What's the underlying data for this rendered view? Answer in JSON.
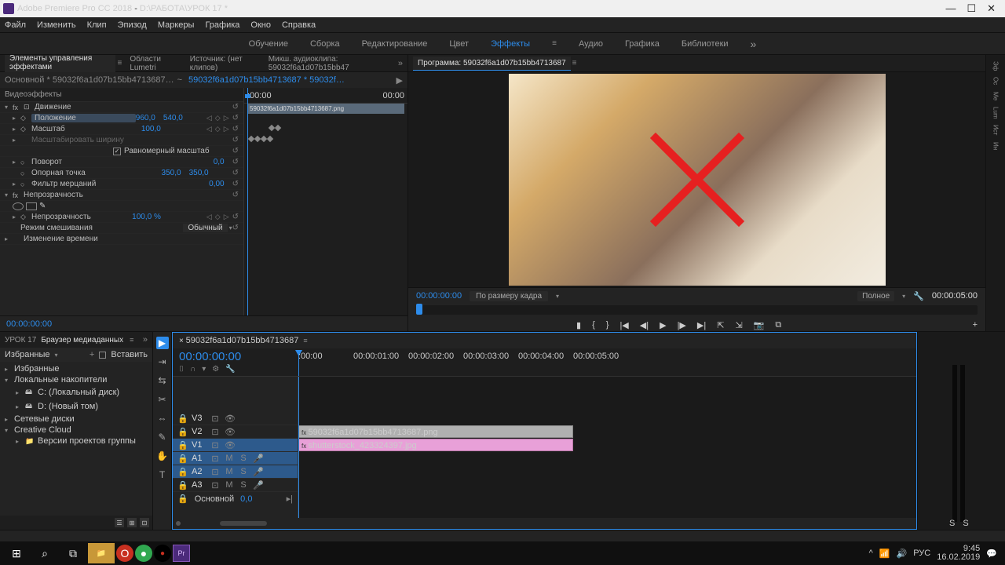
{
  "titlebar": {
    "app": "Adobe Premiere Pro CC 2018",
    "doc": "D:\\РАБОТА\\УРОК 17 *"
  },
  "menubar": [
    "Файл",
    "Изменить",
    "Клип",
    "Эпизод",
    "Маркеры",
    "Графика",
    "Окно",
    "Справка"
  ],
  "workspaces": {
    "items": [
      "Обучение",
      "Сборка",
      "Редактирование",
      "Цвет",
      "Эффекты",
      "Аудио",
      "Графика",
      "Библиотеки"
    ],
    "active": 4
  },
  "effectPanel": {
    "tabs": [
      "Элементы управления эффектами",
      "Области Lumetri",
      "Источник: (нет клипов)",
      "Микш. аудиоклипа: 59032f6a1d07b15bb47"
    ],
    "activeTab": 0,
    "header": {
      "src": "Основной * 59032f6a1d07b15bb4713687…",
      "clip": "59032f6a1d07b15bb4713687 * 59032f…"
    },
    "miniRuler": {
      "start": ":00:00",
      "end": "00:00"
    },
    "clipName": "59032f6a1d07b15bb4713687.png",
    "sections": {
      "video": "Видеоэффекты",
      "motion": "Движение",
      "position": {
        "label": "Положение",
        "x": "960,0",
        "y": "540,0"
      },
      "scale": {
        "label": "Масштаб",
        "val": "100,0"
      },
      "scalew": {
        "label": "Масштабировать ширину"
      },
      "uniform": {
        "label": "Равномерный масштаб",
        "checked": true
      },
      "rotation": {
        "label": "Поворот",
        "val": "0,0"
      },
      "anchor": {
        "label": "Опорная точка",
        "x": "350,0",
        "y": "350,0"
      },
      "flicker": {
        "label": "Фильтр мерцаний",
        "val": "0,00"
      },
      "opacity": {
        "label": "Непрозрачность"
      },
      "opacityVal": {
        "label": "Непрозрачность",
        "val": "100,0 %"
      },
      "blend": {
        "label": "Режим смешивания",
        "val": "Обычный"
      },
      "timeremap": {
        "label": "Изменение времени"
      }
    }
  },
  "sourceTc": "00:00:00:00",
  "program": {
    "tab": "Программа: 59032f6a1d07b15bb4713687",
    "tc": "00:00:00:00",
    "fit": "По размеру кадра",
    "quality": "Полное",
    "duration": "00:00:05:00"
  },
  "sidePanels": [
    "Эф",
    "Ос",
    "Ме",
    "Lum",
    "Ист",
    "Ин"
  ],
  "project": {
    "tabs": [
      "УРОК 17",
      "Браузер медиаданных"
    ],
    "activeTab": 1,
    "subbar": {
      "fav": "Избранные",
      "insert": "Вставить"
    },
    "tree": [
      {
        "lvl": 0,
        "chev": "▸",
        "label": "Избранные"
      },
      {
        "lvl": 0,
        "chev": "▾",
        "label": "Локальные накопители"
      },
      {
        "lvl": 1,
        "chev": "▸",
        "label": "C: (Локальный диск)",
        "icon": "🖴"
      },
      {
        "lvl": 1,
        "chev": "▸",
        "label": "D: (Новый том)",
        "icon": "🖴"
      },
      {
        "lvl": 0,
        "chev": "▸",
        "label": "Сетевые диски"
      },
      {
        "lvl": 0,
        "chev": "▾",
        "label": "Creative Cloud"
      },
      {
        "lvl": 1,
        "chev": "▸",
        "label": "Версии проектов группы",
        "icon": "📁"
      }
    ]
  },
  "timeline": {
    "tab": "59032f6a1d07b15bb4713687",
    "tc": "00:00:00:00",
    "ruler": [
      ":00:00",
      "00:00:01:00",
      "00:00:02:00",
      "00:00:03:00",
      "00:00:04:00",
      "00:00:05:00"
    ],
    "videoTracks": [
      {
        "label": "V3",
        "selected": false
      },
      {
        "label": "V2",
        "selected": false
      },
      {
        "label": "V1",
        "selected": true
      }
    ],
    "audioTracks": [
      {
        "label": "A1",
        "selected": true
      },
      {
        "label": "A2",
        "selected": true
      },
      {
        "label": "A3",
        "selected": false
      }
    ],
    "master": {
      "label": "Основной",
      "val": "0,0"
    },
    "clips": {
      "v2": "59032f6a1d07b15bb4713687.png",
      "v1": "shutterstock_423324397.jpg"
    }
  },
  "taskbar": {
    "lang": "РУС",
    "time": "9:45",
    "date": "16.02.2019"
  }
}
